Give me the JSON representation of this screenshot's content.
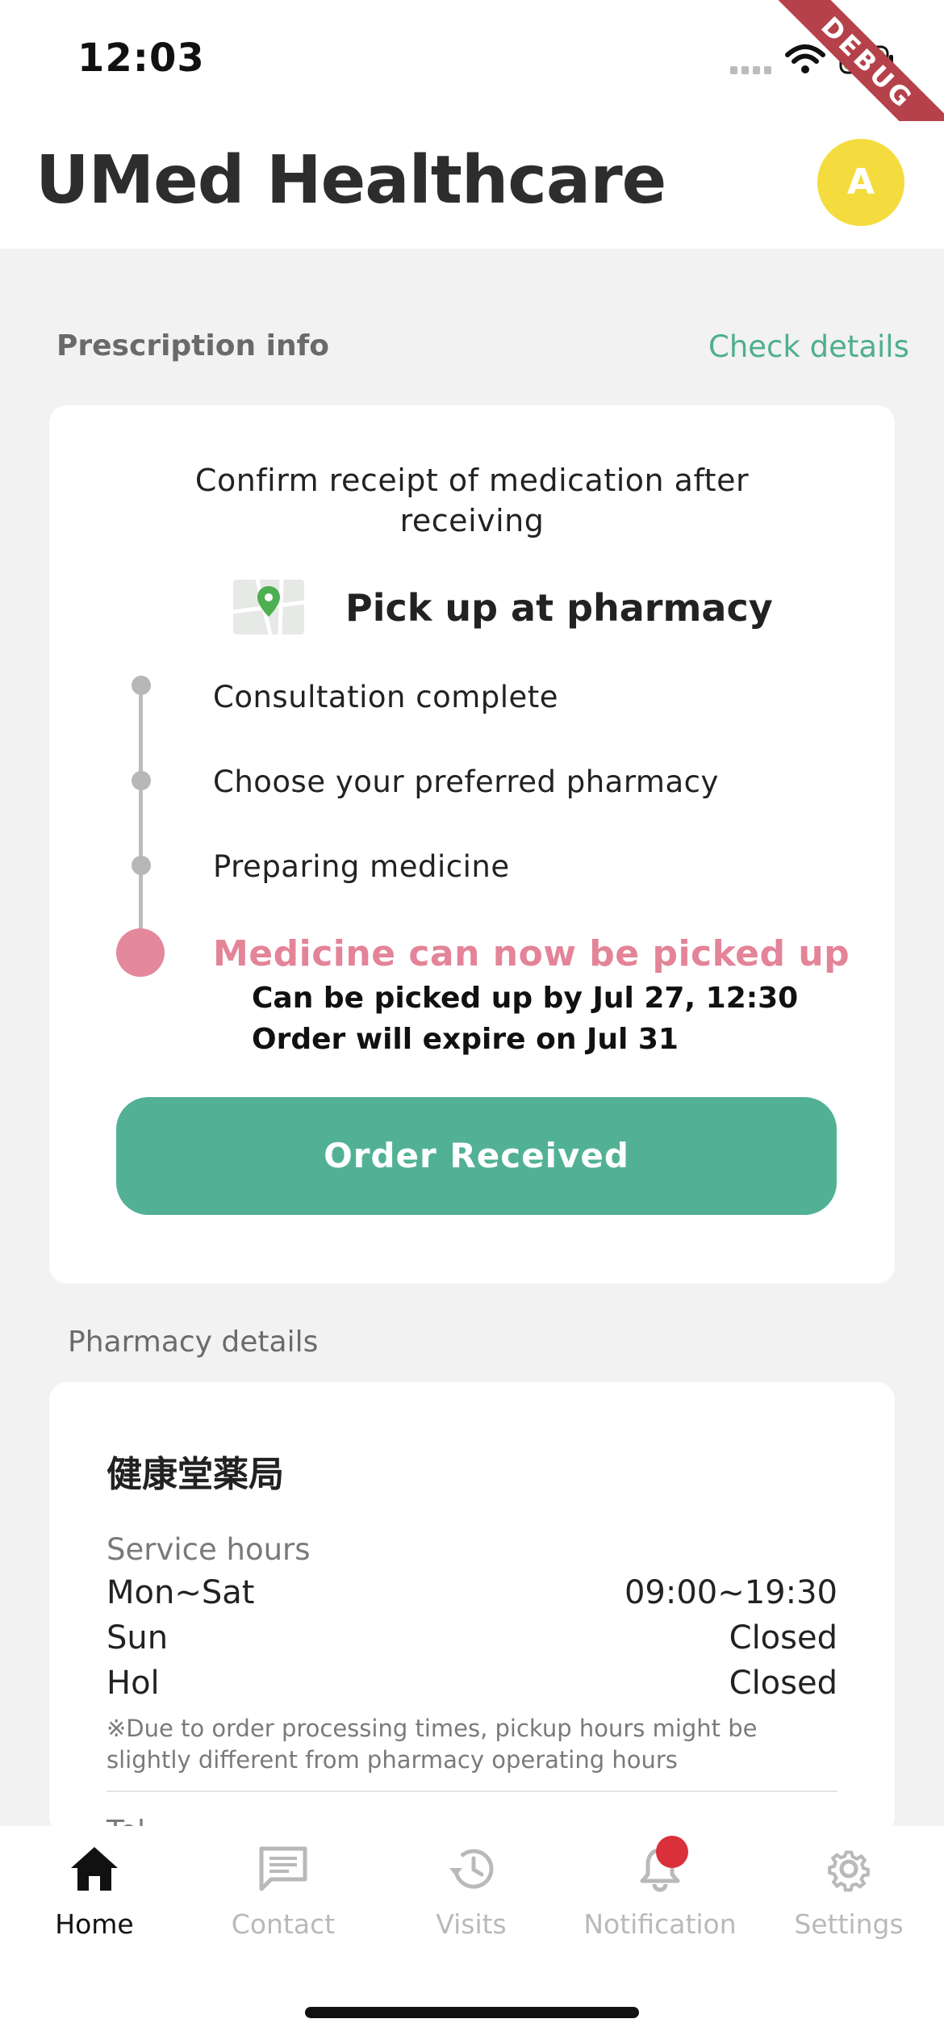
{
  "status_bar": {
    "time": "12:03",
    "debug_label": "DEBUG"
  },
  "header": {
    "title": "UMed Healthcare",
    "avatar_initial": "A"
  },
  "prescription": {
    "section_label": "Prescription info",
    "check_details": "Check details",
    "confirm_text": "Confirm receipt of medication after receiving",
    "pickup_title": "Pick up at pharmacy",
    "steps": [
      "Consultation complete",
      "Choose your preferred pharmacy",
      "Preparing medicine",
      "Medicine can now be picked up"
    ],
    "pickup_by": "Can be picked up by Jul 27, 12:30",
    "expire": "Order will expire on Jul 31",
    "order_button": "Order Received"
  },
  "pharmacy": {
    "section_label": "Pharmacy details",
    "name": "健康堂薬局",
    "hours_label": "Service hours",
    "hours": [
      {
        "day": "Mon~Sat",
        "value": "09:00~19:30"
      },
      {
        "day": "Sun",
        "value": "Closed"
      },
      {
        "day": "Hol",
        "value": "Closed"
      }
    ],
    "note": "※Due to order processing times, pickup hours might be slightly different from pharmacy operating hours",
    "tel_label_peek": "Tel"
  },
  "tabs": [
    {
      "label": "Home",
      "icon": "home-icon"
    },
    {
      "label": "Contact",
      "icon": "message-icon"
    },
    {
      "label": "Visits",
      "icon": "history-icon"
    },
    {
      "label": "Notification",
      "icon": "bell-icon"
    },
    {
      "label": "Settings",
      "icon": "gear-icon"
    }
  ],
  "colors": {
    "accent_green": "#52b194",
    "link_green": "#4fae92",
    "pink": "#e4889b",
    "avatar_yellow": "#f4dc3f",
    "badge_red": "#d9303a"
  }
}
